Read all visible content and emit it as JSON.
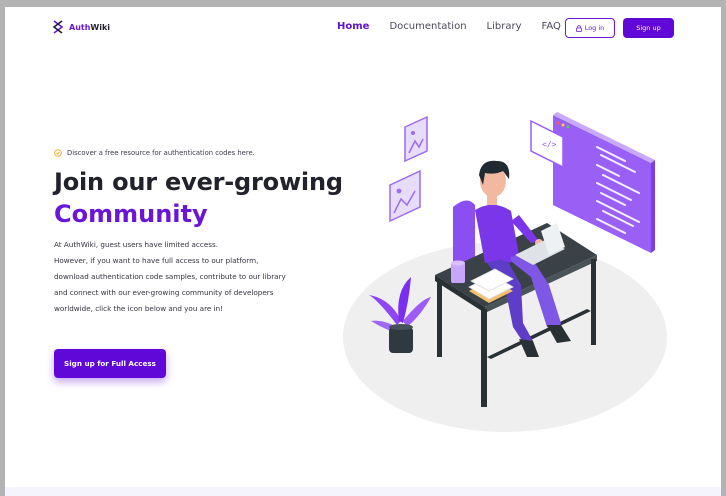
{
  "brand": {
    "name_prefix": "Auth",
    "name_suffix": "Wiki"
  },
  "nav": {
    "links": [
      {
        "label": "Home"
      },
      {
        "label": "Documentation"
      },
      {
        "label": "Library"
      },
      {
        "label": "FAQ"
      }
    ],
    "login_label": "Log in",
    "signup_label": "Sign up"
  },
  "hero": {
    "tagline": "Discover a free resource for authentication codes here.",
    "headline": "Join our ever-growing",
    "headline_accent": "Community",
    "body_lines": [
      "At AuthWiki, guest users have limited access.",
      "However, if you want to have full access to our platform,",
      "download authentication code samples, contribute to our library",
      "and connect with our ever-growing community of developers",
      "worldwide, click the icon below and you are in!"
    ],
    "cta_label": "Sign up for Full Access"
  },
  "colors": {
    "accent": "#6a16d8",
    "button": "#6008d8",
    "tagline_icon": "#f5a623"
  },
  "icons": {
    "brand": "double-chevron-logo-icon",
    "login": "lock-icon",
    "tagline": "check-circle-icon"
  }
}
